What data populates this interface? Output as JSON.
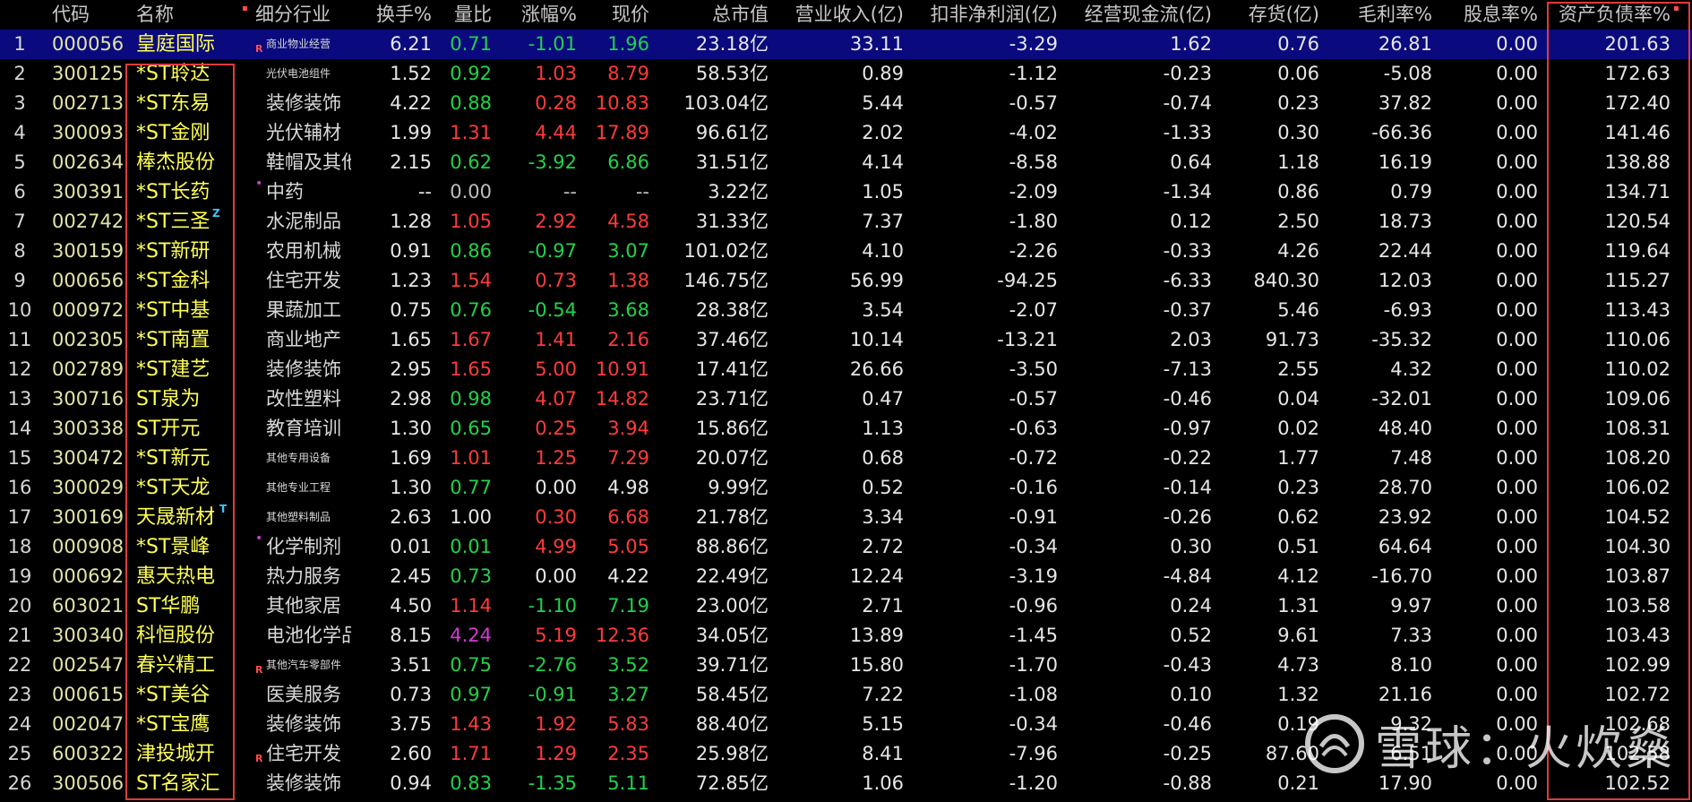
{
  "headers": [
    "",
    "代码",
    "名称",
    "细分行业",
    "换手%",
    "量比",
    "涨幅%",
    "现价",
    "总市值",
    "营业收入(亿)",
    "扣非净利润(亿)",
    "经营现金流(亿)",
    "存货(亿)",
    "毛利率%",
    "股息率%",
    "资产负债率%"
  ],
  "colors": {
    "red": "#ff3b3b",
    "green": "#21d24a",
    "magenta": "#d23ad2",
    "white": "#e6e6e6",
    "gray": "#bdbdbd",
    "highlight_box": "#e03b3b",
    "selected_row": "#0a0a7e"
  },
  "rows": [
    {
      "idx": "1",
      "code": "000056",
      "name": "皇庭国际",
      "industry": "商业物业经营",
      "ind_small": true,
      "tag": "R",
      "turnover": "6.21",
      "vol_ratio": "0.71",
      "vr_color": "green",
      "change": "-1.01",
      "price": "1.96",
      "pc_color": "green",
      "mkt_cap": "23.18亿",
      "revenue": "33.11",
      "net_profit": "-3.29",
      "cash_flow": "1.62",
      "inventory": "0.76",
      "gross_margin": "26.81",
      "dividend": "0.00",
      "debt_ratio": "201.63",
      "selected": true
    },
    {
      "idx": "2",
      "code": "300125",
      "name": "*ST聆达",
      "industry": "光伏电池组件",
      "ind_small": true,
      "turnover": "1.52",
      "vol_ratio": "0.92",
      "vr_color": "green",
      "change": "1.03",
      "price": "8.79",
      "pc_color": "red",
      "mkt_cap": "58.53亿",
      "revenue": "0.89",
      "net_profit": "-1.12",
      "cash_flow": "-0.23",
      "inventory": "0.06",
      "gross_margin": "-5.08",
      "dividend": "0.00",
      "debt_ratio": "172.63"
    },
    {
      "idx": "3",
      "code": "002713",
      "name": "*ST东易",
      "industry": "装修装饰",
      "turnover": "4.22",
      "vol_ratio": "0.88",
      "vr_color": "green",
      "change": "0.28",
      "price": "10.83",
      "pc_color": "red",
      "mkt_cap": "103.04亿",
      "revenue": "5.44",
      "net_profit": "-0.57",
      "cash_flow": "-0.74",
      "inventory": "0.23",
      "gross_margin": "37.82",
      "dividend": "0.00",
      "debt_ratio": "172.40"
    },
    {
      "idx": "4",
      "code": "300093",
      "name": "*ST金刚",
      "industry": "光伏辅材",
      "turnover": "1.99",
      "vol_ratio": "1.31",
      "vr_color": "red",
      "change": "4.44",
      "price": "17.89",
      "pc_color": "red",
      "mkt_cap": "96.61亿",
      "revenue": "2.02",
      "net_profit": "-4.02",
      "cash_flow": "-1.33",
      "inventory": "0.30",
      "gross_margin": "-66.36",
      "dividend": "0.00",
      "debt_ratio": "141.46"
    },
    {
      "idx": "5",
      "code": "002634",
      "name": "棒杰股份",
      "industry": "鞋帽及其他",
      "turnover": "2.15",
      "vol_ratio": "0.62",
      "vr_color": "green",
      "change": "-3.92",
      "price": "6.86",
      "pc_color": "green",
      "mkt_cap": "31.51亿",
      "revenue": "4.14",
      "net_profit": "-8.58",
      "cash_flow": "0.64",
      "inventory": "1.18",
      "gross_margin": "16.19",
      "dividend": "0.00",
      "debt_ratio": "138.88"
    },
    {
      "idx": "6",
      "code": "300391",
      "name": "*ST长药",
      "industry": "中药",
      "tag": "dot",
      "turnover": "--",
      "vol_ratio": "0.00",
      "vr_color": "gray",
      "change": "--",
      "price": "--",
      "pc_color": "gray",
      "mkt_cap": "3.22亿",
      "revenue": "1.05",
      "net_profit": "-2.09",
      "cash_flow": "-1.34",
      "inventory": "0.86",
      "gross_margin": "0.79",
      "dividend": "0.00",
      "debt_ratio": "134.71"
    },
    {
      "idx": "7",
      "code": "002742",
      "name": "*ST三圣",
      "name_tag": "Z",
      "industry": "水泥制品",
      "turnover": "1.28",
      "vol_ratio": "1.05",
      "vr_color": "red",
      "change": "2.92",
      "price": "4.58",
      "pc_color": "red",
      "mkt_cap": "31.33亿",
      "revenue": "7.37",
      "net_profit": "-1.80",
      "cash_flow": "0.12",
      "inventory": "2.50",
      "gross_margin": "18.73",
      "dividend": "0.00",
      "debt_ratio": "120.54"
    },
    {
      "idx": "8",
      "code": "300159",
      "name": "*ST新研",
      "industry": "农用机械",
      "turnover": "0.91",
      "vol_ratio": "0.86",
      "vr_color": "green",
      "change": "-0.97",
      "price": "3.07",
      "pc_color": "green",
      "mkt_cap": "101.02亿",
      "revenue": "4.10",
      "net_profit": "-2.26",
      "cash_flow": "-0.33",
      "inventory": "4.26",
      "gross_margin": "22.44",
      "dividend": "0.00",
      "debt_ratio": "119.64"
    },
    {
      "idx": "9",
      "code": "000656",
      "name": "*ST金科",
      "industry": "住宅开发",
      "turnover": "1.23",
      "vol_ratio": "1.54",
      "vr_color": "red",
      "change": "0.73",
      "price": "1.38",
      "pc_color": "red",
      "mkt_cap": "146.75亿",
      "revenue": "56.99",
      "net_profit": "-94.25",
      "cash_flow": "-6.33",
      "inventory": "840.30",
      "gross_margin": "12.03",
      "dividend": "0.00",
      "debt_ratio": "115.27"
    },
    {
      "idx": "10",
      "code": "000972",
      "name": "*ST中基",
      "industry": "果蔬加工",
      "turnover": "0.75",
      "vol_ratio": "0.76",
      "vr_color": "green",
      "change": "-0.54",
      "price": "3.68",
      "pc_color": "green",
      "mkt_cap": "28.38亿",
      "revenue": "3.54",
      "net_profit": "-2.07",
      "cash_flow": "-0.37",
      "inventory": "5.46",
      "gross_margin": "-6.93",
      "dividend": "0.00",
      "debt_ratio": "113.43"
    },
    {
      "idx": "11",
      "code": "002305",
      "name": "*ST南置",
      "industry": "商业地产",
      "turnover": "1.65",
      "vol_ratio": "1.67",
      "vr_color": "red",
      "change": "1.41",
      "price": "2.16",
      "pc_color": "red",
      "mkt_cap": "37.46亿",
      "revenue": "10.14",
      "net_profit": "-13.21",
      "cash_flow": "2.03",
      "inventory": "91.73",
      "gross_margin": "-35.32",
      "dividend": "0.00",
      "debt_ratio": "110.06"
    },
    {
      "idx": "12",
      "code": "002789",
      "name": "*ST建艺",
      "industry": "装修装饰",
      "turnover": "2.95",
      "vol_ratio": "1.65",
      "vr_color": "red",
      "change": "5.00",
      "price": "10.91",
      "pc_color": "red",
      "mkt_cap": "17.41亿",
      "revenue": "26.66",
      "net_profit": "-3.50",
      "cash_flow": "-7.13",
      "inventory": "2.55",
      "gross_margin": "4.32",
      "dividend": "0.00",
      "debt_ratio": "110.02"
    },
    {
      "idx": "13",
      "code": "300716",
      "name": "ST泉为",
      "industry": "改性塑料",
      "turnover": "2.98",
      "vol_ratio": "0.98",
      "vr_color": "green",
      "change": "4.07",
      "price": "14.82",
      "pc_color": "red",
      "mkt_cap": "23.71亿",
      "revenue": "0.47",
      "net_profit": "-0.57",
      "cash_flow": "-0.46",
      "inventory": "0.04",
      "gross_margin": "-32.01",
      "dividend": "0.00",
      "debt_ratio": "109.06"
    },
    {
      "idx": "14",
      "code": "300338",
      "name": "ST开元",
      "industry": "教育培训",
      "turnover": "1.30",
      "vol_ratio": "0.65",
      "vr_color": "green",
      "change": "0.25",
      "price": "3.94",
      "pc_color": "red",
      "mkt_cap": "15.86亿",
      "revenue": "1.13",
      "net_profit": "-0.63",
      "cash_flow": "-0.97",
      "inventory": "0.02",
      "gross_margin": "48.40",
      "dividend": "0.00",
      "debt_ratio": "108.31"
    },
    {
      "idx": "15",
      "code": "300472",
      "name": "*ST新元",
      "industry": "其他专用设备",
      "ind_small": true,
      "turnover": "1.69",
      "vol_ratio": "1.01",
      "vr_color": "red",
      "change": "1.25",
      "price": "7.29",
      "pc_color": "red",
      "mkt_cap": "20.07亿",
      "revenue": "0.68",
      "net_profit": "-0.72",
      "cash_flow": "-0.22",
      "inventory": "1.77",
      "gross_margin": "7.48",
      "dividend": "0.00",
      "debt_ratio": "108.20"
    },
    {
      "idx": "16",
      "code": "300029",
      "name": "*ST天龙",
      "industry": "其他专业工程",
      "ind_small": true,
      "turnover": "1.30",
      "vol_ratio": "0.77",
      "vr_color": "green",
      "change": "0.00",
      "price": "4.98",
      "pc_color": "white",
      "mkt_cap": "9.99亿",
      "revenue": "0.52",
      "net_profit": "-0.16",
      "cash_flow": "-0.14",
      "inventory": "0.23",
      "gross_margin": "28.70",
      "dividend": "0.00",
      "debt_ratio": "106.02"
    },
    {
      "idx": "17",
      "code": "300169",
      "name": "天晟新材",
      "name_tag": "T",
      "industry": "其他塑料制品",
      "ind_small": true,
      "turnover": "2.63",
      "vol_ratio": "1.00",
      "vr_color": "white",
      "change": "0.30",
      "price": "6.68",
      "pc_color": "red",
      "mkt_cap": "21.78亿",
      "revenue": "3.34",
      "net_profit": "-0.91",
      "cash_flow": "-0.26",
      "inventory": "0.62",
      "gross_margin": "23.92",
      "dividend": "0.00",
      "debt_ratio": "104.52"
    },
    {
      "idx": "18",
      "code": "000908",
      "name": "*ST景峰",
      "industry": "化学制剂",
      "tag": "dot",
      "turnover": "0.01",
      "vol_ratio": "0.01",
      "vr_color": "green",
      "change": "4.99",
      "price": "5.05",
      "pc_color": "red",
      "mkt_cap": "88.86亿",
      "revenue": "2.72",
      "net_profit": "-0.34",
      "cash_flow": "0.30",
      "inventory": "0.51",
      "gross_margin": "64.64",
      "dividend": "0.00",
      "debt_ratio": "104.30"
    },
    {
      "idx": "19",
      "code": "000692",
      "name": "惠天热电",
      "industry": "热力服务",
      "turnover": "2.45",
      "vol_ratio": "0.73",
      "vr_color": "green",
      "change": "0.00",
      "price": "4.22",
      "pc_color": "white",
      "mkt_cap": "22.49亿",
      "revenue": "12.24",
      "net_profit": "-3.19",
      "cash_flow": "-4.84",
      "inventory": "4.12",
      "gross_margin": "-16.70",
      "dividend": "0.00",
      "debt_ratio": "103.87"
    },
    {
      "idx": "20",
      "code": "603021",
      "name": "ST华鹏",
      "industry": "其他家居",
      "turnover": "4.50",
      "vol_ratio": "1.14",
      "vr_color": "red",
      "change": "-1.10",
      "price": "7.19",
      "pc_color": "green",
      "mkt_cap": "23.00亿",
      "revenue": "2.71",
      "net_profit": "-0.96",
      "cash_flow": "0.24",
      "inventory": "1.31",
      "gross_margin": "9.97",
      "dividend": "0.00",
      "debt_ratio": "103.58"
    },
    {
      "idx": "21",
      "code": "300340",
      "name": "科恒股份",
      "industry": "电池化学品",
      "turnover": "8.15",
      "vol_ratio": "4.24",
      "vr_color": "magenta",
      "change": "5.19",
      "price": "12.36",
      "pc_color": "red",
      "mkt_cap": "34.05亿",
      "revenue": "13.89",
      "net_profit": "-1.45",
      "cash_flow": "0.52",
      "inventory": "9.61",
      "gross_margin": "7.33",
      "dividend": "0.00",
      "debt_ratio": "103.43"
    },
    {
      "idx": "22",
      "code": "002547",
      "name": "春兴精工",
      "industry": "其他汽车零部件",
      "ind_small": true,
      "tag": "R",
      "turnover": "3.51",
      "vol_ratio": "0.75",
      "vr_color": "green",
      "change": "-2.76",
      "price": "3.52",
      "pc_color": "green",
      "mkt_cap": "39.71亿",
      "revenue": "15.80",
      "net_profit": "-1.70",
      "cash_flow": "-0.43",
      "inventory": "4.73",
      "gross_margin": "8.10",
      "dividend": "0.00",
      "debt_ratio": "102.99"
    },
    {
      "idx": "23",
      "code": "000615",
      "name": "*ST美谷",
      "industry": "医美服务",
      "turnover": "0.73",
      "vol_ratio": "0.97",
      "vr_color": "green",
      "change": "-0.91",
      "price": "3.27",
      "pc_color": "green",
      "mkt_cap": "58.45亿",
      "revenue": "7.22",
      "net_profit": "-1.08",
      "cash_flow": "0.10",
      "inventory": "1.32",
      "gross_margin": "21.16",
      "dividend": "0.00",
      "debt_ratio": "102.72"
    },
    {
      "idx": "24",
      "code": "002047",
      "name": "*ST宝鹰",
      "industry": "装修装饰",
      "turnover": "3.75",
      "vol_ratio": "1.43",
      "vr_color": "red",
      "change": "1.92",
      "price": "5.83",
      "pc_color": "red",
      "mkt_cap": "88.40亿",
      "revenue": "5.15",
      "net_profit": "-0.34",
      "cash_flow": "-0.46",
      "inventory": "0.19",
      "gross_margin": "9.32",
      "dividend": "0.00",
      "debt_ratio": "102.68"
    },
    {
      "idx": "25",
      "code": "600322",
      "name": "津投城开",
      "industry": "住宅开发",
      "tag": "R",
      "turnover": "2.60",
      "vol_ratio": "1.71",
      "vr_color": "red",
      "change": "1.29",
      "price": "2.35",
      "pc_color": "red",
      "mkt_cap": "25.98亿",
      "revenue": "8.41",
      "net_profit": "-7.96",
      "cash_flow": "-0.25",
      "inventory": "87.60",
      "gross_margin": "6.51",
      "dividend": "0.00",
      "debt_ratio": "102.58"
    },
    {
      "idx": "26",
      "code": "300506",
      "name": "ST名家汇",
      "industry": "装修装饰",
      "turnover": "0.94",
      "vol_ratio": "0.83",
      "vr_color": "green",
      "change": "-1.35",
      "price": "5.11",
      "pc_color": "green",
      "mkt_cap": "72.85亿",
      "revenue": "1.06",
      "net_profit": "-1.20",
      "cash_flow": "-0.88",
      "inventory": "0.21",
      "gross_margin": "17.90",
      "dividend": "0.00",
      "debt_ratio": "102.52"
    }
  ],
  "watermark": {
    "text": "雪球：火炊燊"
  }
}
